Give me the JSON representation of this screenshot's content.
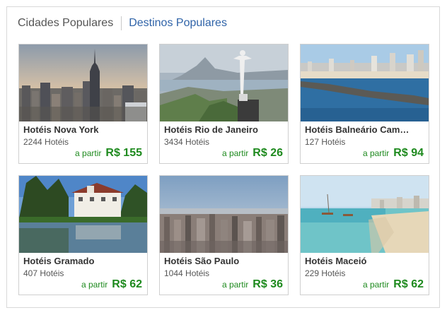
{
  "tabs": {
    "popular_cities": "Cidades Populares",
    "popular_destinations": "Destinos Populares"
  },
  "colors": {
    "price": "#1e8a1e",
    "active_tab": "#2f63a8"
  },
  "cards": [
    {
      "name": "Hotéis Nova York",
      "count": "2244 Hotéis",
      "from": "a partir",
      "price": "R$ 155",
      "image": "new-york-skyline-photo"
    },
    {
      "name": "Hotéis Rio de Janeiro",
      "count": "3434 Hotéis",
      "from": "a partir",
      "price": "R$ 26",
      "image": "rio-christ-redeemer-photo"
    },
    {
      "name": "Hotéis Balneário Cam…",
      "count": "127 Hotéis",
      "from": "a partir",
      "price": "R$ 94",
      "image": "balneario-camboriu-beach-photo"
    },
    {
      "name": "Hotéis Gramado",
      "count": "407 Hotéis",
      "from": "a partir",
      "price": "R$ 62",
      "image": "gramado-lake-photo"
    },
    {
      "name": "Hotéis São Paulo",
      "count": "1044 Hotéis",
      "from": "a partir",
      "price": "R$ 36",
      "image": "sao-paulo-skyline-photo"
    },
    {
      "name": "Hotéis Maceió",
      "count": "229 Hotéis",
      "from": "a partir",
      "price": "R$ 62",
      "image": "maceio-beach-photo"
    }
  ]
}
